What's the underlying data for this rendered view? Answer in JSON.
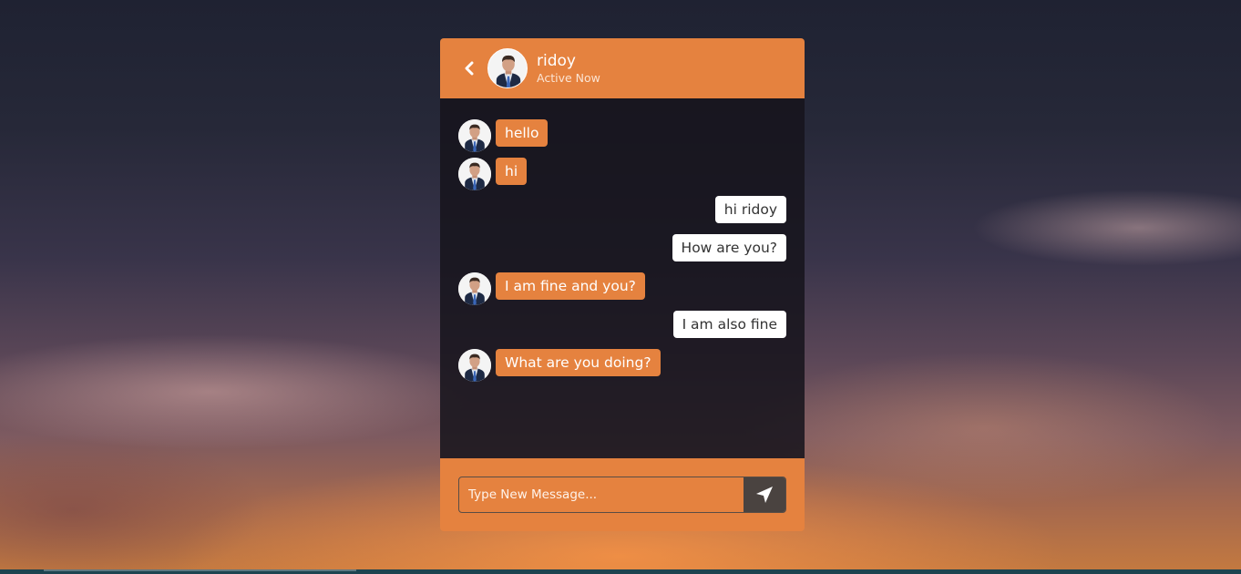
{
  "header": {
    "name": "ridoy",
    "status": "Active Now",
    "back_icon": "chevron-left-icon",
    "avatar_icon": "user-avatar"
  },
  "messages": [
    {
      "direction": "in",
      "text": "hello"
    },
    {
      "direction": "in",
      "text": "hi"
    },
    {
      "direction": "out",
      "text": "hi ridoy"
    },
    {
      "direction": "out",
      "text": "How are you?"
    },
    {
      "direction": "in",
      "text": "I am fine and you?"
    },
    {
      "direction": "out",
      "text": "I am also fine"
    },
    {
      "direction": "in",
      "text": "What are you doing?"
    }
  ],
  "composer": {
    "placeholder": "Type New Message...",
    "send_icon": "paper-plane-icon"
  },
  "colors": {
    "accent": "#e5823f",
    "chat_body": "#16141c",
    "outgoing_bubble": "#ffffff",
    "send_button": "#4a4340"
  }
}
